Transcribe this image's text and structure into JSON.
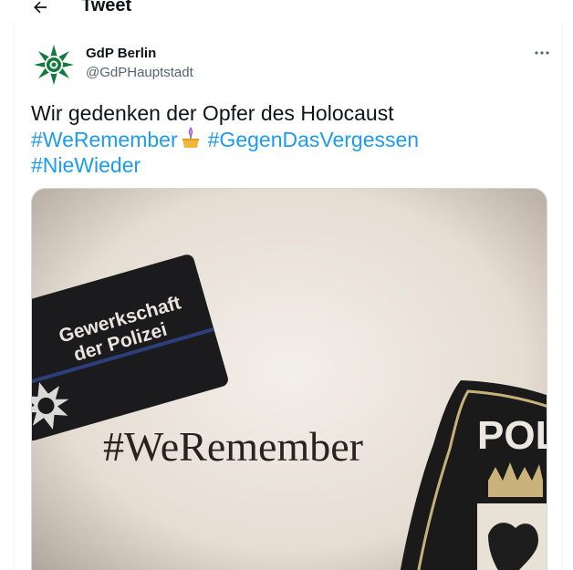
{
  "header": {
    "title": "Tweet",
    "back_icon": "arrow-left-icon"
  },
  "tweet": {
    "author": {
      "name": "GdP Berlin",
      "handle": "@GdPHauptstadt"
    },
    "text_plain": "Wir gedenken der Opfer des Holocaust",
    "hashtags": [
      "#WeRemember",
      "#GegenDasVergessen",
      "#NieWieder"
    ],
    "emoji_icon": "candle-icon",
    "more_icon": "more-dots-icon"
  },
  "media": {
    "patch_left_text": [
      "Gewerkschaft",
      "der Polizei"
    ],
    "center_text": "#WeRemember",
    "patch_right_text": "POL"
  },
  "colors": {
    "hashtag": "#1d9bf0",
    "text": "#0f1419",
    "secondary": "#536471",
    "avatar_green": "#0f7a3a"
  }
}
